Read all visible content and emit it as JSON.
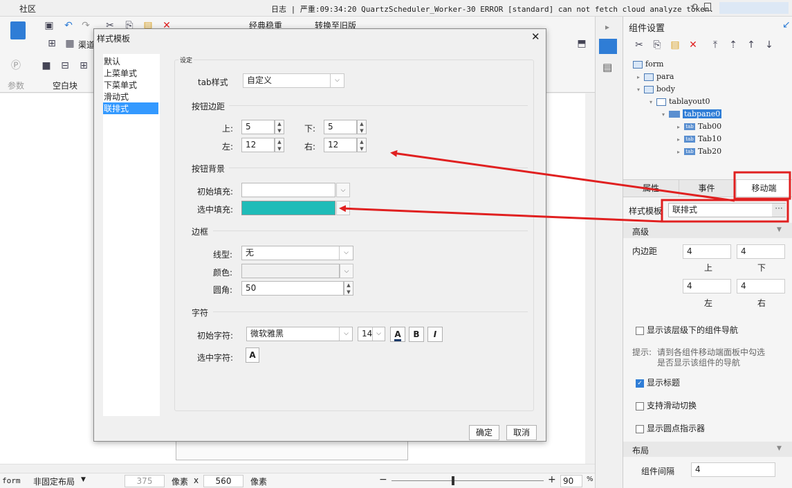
{
  "topbar": {
    "left_label": "社区",
    "log_text": "日志 | 严重:09:34:20 QuartzScheduler_Worker-30 ERROR [standard] can not fetch cloud analyze token."
  },
  "toolbar": {
    "classic_label": "经典稳重",
    "switch_old_label": "转换至旧版",
    "channel_label": "渠道",
    "param_label": "参数",
    "blank_block_label": "空白块"
  },
  "dialog": {
    "title": "样式模板",
    "list_items": [
      "默认",
      "上菜单式",
      "下菜单式",
      "滑动式",
      "联排式"
    ],
    "selected_index": 4,
    "settings_label": "设定",
    "tab_style_label": "tab样式",
    "tab_style_value": "自定义",
    "margin_section": "按钮边距",
    "top_label": "上:",
    "top_value": "5",
    "bottom_label": "下:",
    "bottom_value": "5",
    "left_label": "左:",
    "left_value": "12",
    "right_label": "右:",
    "right_value": "12",
    "bg_section": "按钮背景",
    "init_fill_label": "初始填充:",
    "selected_fill_label": "选中填充:",
    "selected_fill_color": "#1fbcb8",
    "border_section": "边框",
    "line_type_label": "线型:",
    "line_type_value": "无",
    "color_label": "颜色:",
    "radius_label": "圆角:",
    "radius_value": "50",
    "char_section": "字符",
    "init_char_label": "初始字符:",
    "font_value": "微软雅黑",
    "font_size": "14",
    "bold_label": "B",
    "italic_label": "I",
    "selected_char_label": "选中字符:",
    "ok_label": "确定",
    "cancel_label": "取消",
    "close_label": "✕"
  },
  "right_panel": {
    "title": "组件设置",
    "tree": [
      {
        "label": "form",
        "icon": "tree-icon"
      },
      {
        "label": "para",
        "icon": "widget-icon"
      },
      {
        "label": "body",
        "icon": "widget-icon"
      },
      {
        "label": "tablayout0",
        "icon": "layout-icon"
      },
      {
        "label": "tabpane0",
        "icon": "tab-icon"
      },
      {
        "label": "Tab00",
        "icon": "tab-icon"
      },
      {
        "label": "Tab10",
        "icon": "tab-icon"
      },
      {
        "label": "Tab20",
        "icon": "tab-icon"
      }
    ],
    "tabs": [
      "属性",
      "事件",
      "移动端"
    ],
    "style_template_label": "样式模板",
    "style_template_value": "联排式",
    "advanced_label": "高级",
    "padding_label": "内边距",
    "pad_top": "4",
    "pad_bottom": "4",
    "pad_left": "4",
    "pad_right": "4",
    "top_caption": "上",
    "bottom_caption": "下",
    "left_caption": "左",
    "right_caption": "右",
    "show_nav_label": "显示该层级下的组件导航",
    "hint_label": "提示:",
    "hint_text_1": "请到各组件移动端面板中勾选",
    "hint_text_2": "是否显示该组件的导航",
    "show_title_label": "显示标题",
    "swipe_label": "支持滑动切换",
    "dots_label": "显示圆点指示器",
    "layout_label": "布局",
    "spacing_label": "组件间隔",
    "spacing_value": "4"
  },
  "statusbar": {
    "form_label": "form",
    "layout_mode": "非固定布局",
    "width_value": "375",
    "pixel_label": "像素",
    "x_label": "x",
    "height_value": "560",
    "pixel_label2": "像素",
    "zoom_value": "90",
    "percent": "%"
  },
  "colors": {
    "accent": "#2f7dd6",
    "highlight_red": "#e02020",
    "teal_fill": "#1fbcb8"
  }
}
